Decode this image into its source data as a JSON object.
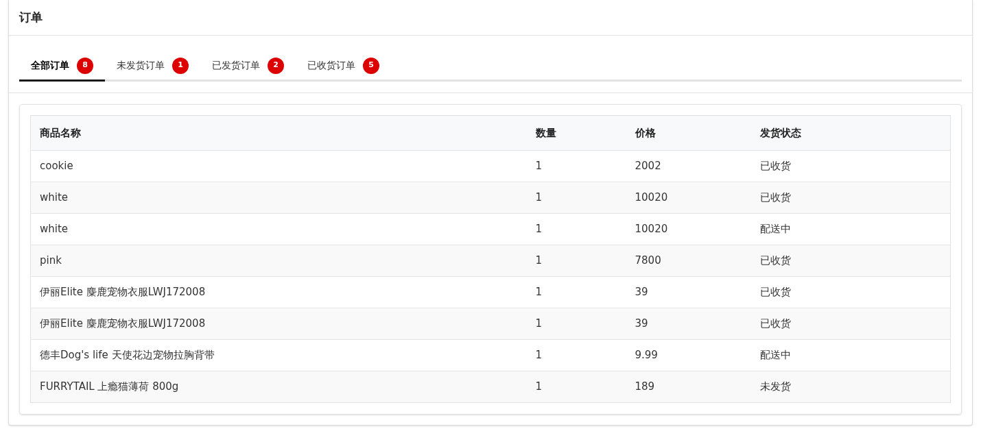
{
  "title": "订单",
  "tabs": [
    {
      "label": "全部订单",
      "count": "8",
      "selected": true
    },
    {
      "label": "未发货订单",
      "count": "1",
      "selected": false
    },
    {
      "label": "已发货订单",
      "count": "2",
      "selected": false
    },
    {
      "label": "已收货订单",
      "count": "5",
      "selected": false
    }
  ],
  "table": {
    "columns": [
      "商品名称",
      "数量",
      "价格",
      "发货状态"
    ],
    "rows": [
      [
        "cookie",
        "1",
        "2002",
        "已收货"
      ],
      [
        "white",
        "1",
        "10020",
        "已收货"
      ],
      [
        "white",
        "1",
        "10020",
        "配送中"
      ],
      [
        "pink",
        "1",
        "7800",
        "已收货"
      ],
      [
        "伊丽Elite 麋鹿宠物衣服LWJ172008",
        "1",
        "39",
        "已收货"
      ],
      [
        "伊丽Elite 麋鹿宠物衣服LWJ172008",
        "1",
        "39",
        "已收货"
      ],
      [
        "德丰Dog's life 天使花边宠物拉胸背带",
        "1",
        "9.99",
        "配送中"
      ],
      [
        "FURRYTAIL 上瘾猫薄荷 800g",
        "1",
        "189",
        "未发货"
      ]
    ]
  }
}
